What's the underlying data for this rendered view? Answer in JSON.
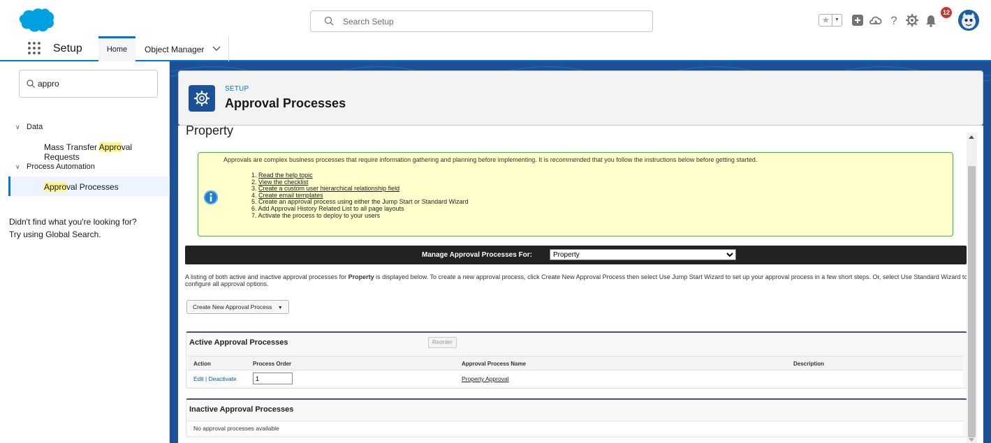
{
  "header": {
    "search_placeholder": "Search Setup",
    "notification_count": "12",
    "icons": [
      "salesforce-cloud-icon",
      "search-icon",
      "favorites-star-icon",
      "favorites-dropdown-icon",
      "global-actions-icon",
      "trailhead-icon",
      "help-icon",
      "setup-gear-icon",
      "notifications-bell-icon",
      "avatar-icon"
    ]
  },
  "context_bar": {
    "app_name": "Setup",
    "tabs": [
      {
        "label": "Home"
      },
      {
        "label": "Object Manager"
      }
    ]
  },
  "sidebar": {
    "quick_find_value": "appro",
    "tree": [
      {
        "label": "Data",
        "children": [
          {
            "label_pre": "Mass Transfer ",
            "label_hl": "Appro",
            "label_post": "val Requests"
          }
        ]
      },
      {
        "label": "Process Automation",
        "children": [
          {
            "label_pre": "",
            "label_hl": "Appro",
            "label_post": "val Processes"
          }
        ]
      }
    ],
    "help_line1": "Didn't find what you're looking for?",
    "help_line2": "Try using Global Search."
  },
  "page_header": {
    "eyebrow": "SETUP",
    "title": "Approval Processes"
  },
  "content": {
    "object_title": "Property",
    "info": {
      "intro": "Approvals are complex business processes that require information gathering and planning before implementing. It is recommended that you follow the instructions below before getting started.",
      "steps": [
        {
          "num": "1.",
          "text": "Read the help topic",
          "link": true
        },
        {
          "num": "2.",
          "text": "View the checklist",
          "link": true
        },
        {
          "num": "3.",
          "text": "Create a custom user hierarchical relationship field",
          "link": true
        },
        {
          "num": "4.",
          "text": "Create email templates",
          "link": true
        },
        {
          "num": "5.",
          "text": "Create an approval process using either the Jump Start or Standard Wizard",
          "link": false
        },
        {
          "num": "6.",
          "text": "Add Approval History Related List to all page layouts",
          "link": false
        },
        {
          "num": "7.",
          "text": "Activate the process to deploy to your users",
          "link": false
        }
      ]
    },
    "manage_bar": {
      "label": "Manage Approval Processes For:",
      "selected": "Property"
    },
    "listing_desc_pre": "A listing of both active and inactive approval processes for ",
    "listing_desc_bold": "Property",
    "listing_desc_post": " is displayed below. To create a new approval process, click Create New Approval Process then select Use Jump Start Wizard to set up your approval process in a few short steps. Or, select Use Standard Wizard to configure all approval options.",
    "create_button": "Create New Approval Process",
    "active_panel": {
      "title": "Active Approval Processes",
      "reorder_button": "Reorder",
      "columns": [
        "Action",
        "Process Order",
        "Approval Process Name",
        "Description"
      ],
      "rows": [
        {
          "edit": "Edit",
          "sep": " | ",
          "deactivate": "Deactivate",
          "order": "1",
          "name": "Property Approval",
          "description": ""
        }
      ]
    },
    "inactive_panel": {
      "title": "Inactive Approval Processes",
      "empty_text": "No approval processes available"
    }
  },
  "colors": {
    "brand_blue": "#0176d3",
    "banner_blue": "#1b5297",
    "info_yellow": "#ffffcc",
    "info_border": "#39b54a",
    "highlight": "#fff48c",
    "badge_red": "#c23934"
  }
}
